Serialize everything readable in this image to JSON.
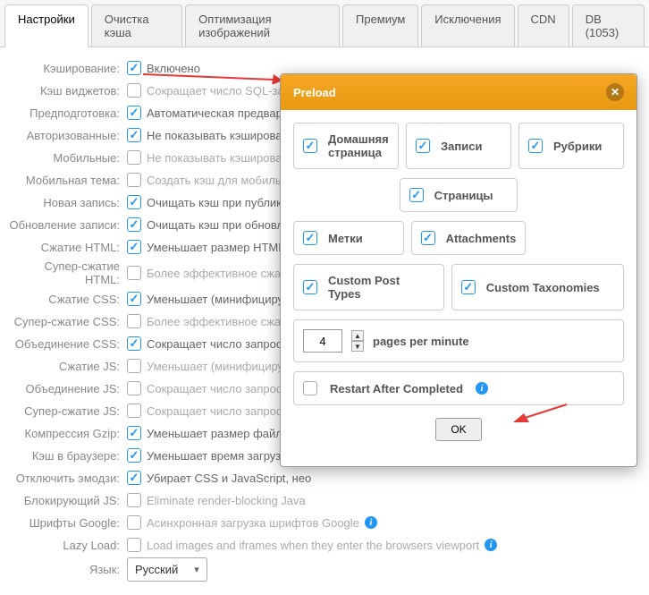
{
  "tabs": [
    "Настройки",
    "Очистка кэша",
    "Оптимизация изображений",
    "Премиум",
    "Исключения",
    "CDN",
    "DB (1053)"
  ],
  "settings": [
    {
      "label": "Кэширование:",
      "on": true,
      "desc": "Включено",
      "dim": false
    },
    {
      "label": "Кэш виджетов:",
      "on": false,
      "desc": "Сокращает число SQL-запросов",
      "dim": true,
      "info": true
    },
    {
      "label": "Предподготовка:",
      "on": true,
      "desc": "Автоматическая предварител",
      "dim": false
    },
    {
      "label": "Авторизованные:",
      "on": true,
      "desc": "Не показывать кэшированну",
      "dim": false
    },
    {
      "label": "Мобильные:",
      "on": false,
      "desc": "Не показывать кэшированну",
      "dim": true
    },
    {
      "label": "Мобильная тема:",
      "on": false,
      "desc": "Создать кэш для мобильной",
      "dim": true
    },
    {
      "label": "Новая запись:",
      "on": true,
      "desc": "Очищать кэш при публикаци",
      "dim": false
    },
    {
      "label": "Обновление записи:",
      "on": true,
      "desc": "Очищать кэш при обновлени",
      "dim": false
    },
    {
      "label": "Сжатие HTML:",
      "on": true,
      "desc": "Уменьшает размер HTML-код",
      "dim": false
    },
    {
      "label": "Супер-сжатие HTML:",
      "on": false,
      "desc": "Более эффективное сжатие H",
      "dim": true
    },
    {
      "label": "Сжатие CSS:",
      "on": true,
      "desc": "Уменьшает (минифицирует) р",
      "dim": false
    },
    {
      "label": "Супер-сжатие CSS:",
      "on": false,
      "desc": "Более эффективное сжатие C",
      "dim": true
    },
    {
      "label": "Объединение CSS:",
      "on": true,
      "desc": "Сокращает число запросов к",
      "dim": false
    },
    {
      "label": "Сжатие JS:",
      "on": false,
      "desc": "Уменьшает (минифицирует) р",
      "dim": true
    },
    {
      "label": "Объединение JS:",
      "on": false,
      "desc": "Сокращает число запросов к",
      "dim": true
    },
    {
      "label": "Супер-сжатие JS:",
      "on": false,
      "desc": "Сокращает число запросов, о",
      "dim": true
    },
    {
      "label": "Компрессия Gzip:",
      "on": true,
      "desc": "Уменьшает размер файлов, о",
      "dim": false
    },
    {
      "label": "Кэш в браузере:",
      "on": true,
      "desc": "Уменьшает время загрузки дл",
      "dim": false
    },
    {
      "label": "Отключить эмодзи:",
      "on": true,
      "desc": "Убирает CSS и JavaScript, нео",
      "dim": false
    },
    {
      "label": "Блокирующий JS:",
      "on": false,
      "desc": "Eliminate render-blocking Java",
      "dim": true
    },
    {
      "label": "Шрифты Google:",
      "on": false,
      "desc": "Асинхронная загрузка шрифтов Google",
      "dim": true,
      "info": true
    },
    {
      "label": "Lazy Load:",
      "on": false,
      "desc": "Load images and iframes when they enter the browsers viewport",
      "dim": true,
      "info": true
    }
  ],
  "lang_label": "Язык:",
  "lang_value": "Русский",
  "dialog": {
    "title": "Preload",
    "home": "Домашняя страница",
    "posts": "Записи",
    "cats": "Рубрики",
    "pages": "Страницы",
    "tags": "Метки",
    "attach": "Attachments",
    "cpt": "Custom Post Types",
    "ctax": "Custom Taxonomies",
    "spin_value": "4",
    "spin_label": "pages per minute",
    "restart": "Restart After Completed",
    "ok": "OK"
  }
}
